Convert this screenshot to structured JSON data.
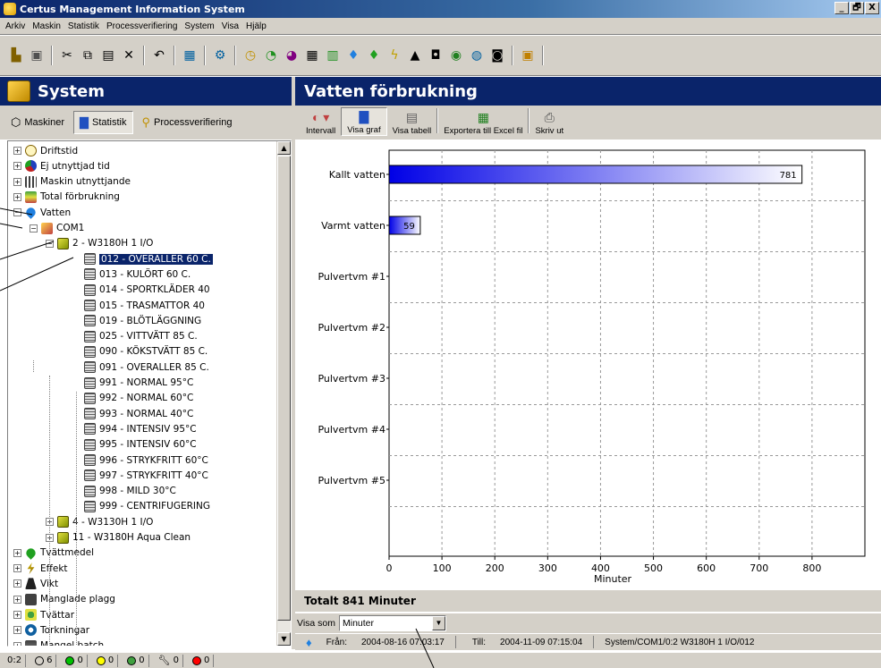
{
  "window": {
    "title": "Certus Management Information System",
    "controls": [
      "_",
      "🗗",
      "X"
    ]
  },
  "menu": [
    "Arkiv",
    "Maskin",
    "Statistik",
    "Processverifiering",
    "System",
    "Visa",
    "Hjälp"
  ],
  "left_panel": {
    "title": "System",
    "tabs": [
      {
        "label": "Maskiner",
        "icon": "cube-icon",
        "active": false
      },
      {
        "label": "Statistik",
        "icon": "bar-chart-icon",
        "active": true
      },
      {
        "label": "Processverifiering",
        "icon": "magnifier-icon",
        "active": false
      }
    ]
  },
  "tree": {
    "root": [
      {
        "label": "Driftstid",
        "icon": "clock-icon"
      },
      {
        "label": "Ej utnyttjad tid",
        "icon": "pie-icon"
      },
      {
        "label": "Maskin utnyttjande",
        "icon": "grid-icon"
      },
      {
        "label": "Total förbrukning",
        "icon": "calculator-icon"
      },
      {
        "label": "Vatten",
        "icon": "water-drop-icon"
      }
    ],
    "com": "COM1",
    "machine": "2 - W3180H 1 I/O",
    "programs": [
      "012 - OVERALLER 60 C.",
      "013 - KULÖRT 60 C.",
      "014 - SPORTKLÄDER 40",
      "015 - TRASMATTOR 40",
      "019 - BLÖTLÄGGNING",
      "025 - VITTVÄTT 85 C.",
      "090 - KÖKSTVÄTT 85 C.",
      "091 - OVERALLER 85 C.",
      "991 - NORMAL 95°C",
      "992 - NORMAL 60°C",
      "993 - NORMAL 40°C",
      "994 - INTENSIV 95°C",
      "995 - INTENSIV 60°C",
      "996 - STRYKFRITT 60°C",
      "997 - STRYKFRITT 40°C",
      "998 - MILD 30°C",
      "999 - CENTRIFUGERING"
    ],
    "other_machines": [
      "4 - W3130H 1 I/O",
      "11 - W3180H Aqua Clean"
    ],
    "tail": [
      {
        "label": "Tvättmedel",
        "icon": "detergent-icon"
      },
      {
        "label": "Effekt",
        "icon": "lightning-icon"
      },
      {
        "label": "Vikt",
        "icon": "weight-icon"
      },
      {
        "label": "Manglade plagg",
        "icon": "clothes-icon"
      },
      {
        "label": "Tvättar",
        "icon": "washer-icon"
      },
      {
        "label": "Torkningar",
        "icon": "dryer-icon"
      },
      {
        "label": "Mangel batch",
        "icon": "mangle-icon"
      }
    ]
  },
  "right_panel": {
    "title": "Vatten förbrukning",
    "tools": [
      {
        "label": "Intervall",
        "icon": "interval-icon",
        "active": false
      },
      {
        "label": "Visa graf",
        "icon": "graph-icon",
        "active": true
      },
      {
        "label": "Visa tabell",
        "icon": "table-icon",
        "active": false
      },
      {
        "label": "Exportera till Excel fil",
        "icon": "excel-icon",
        "active": false
      },
      {
        "label": "Skriv ut",
        "icon": "printer-icon",
        "active": false
      }
    ]
  },
  "chart_data": {
    "type": "bar",
    "orientation": "horizontal",
    "categories": [
      "Kallt vatten",
      "Varmt vatten",
      "Pulvertvm #1",
      "Pulvertvm #2",
      "Pulvertvm #3",
      "Pulvertvm #4",
      "Pulvertvm #5"
    ],
    "values": [
      781,
      59,
      0,
      0,
      0,
      0,
      0
    ],
    "data_labels": [
      "781",
      "59",
      "",
      "",
      "",
      "",
      ""
    ],
    "xlabel": "Minuter",
    "xlim": [
      0,
      900
    ],
    "xticks": [
      0,
      100,
      200,
      300,
      400,
      500,
      600,
      700,
      800
    ],
    "grid": true,
    "colors": {
      "bar_start": "#0000e6",
      "bar_end": "#ffffff"
    }
  },
  "total": {
    "text": "Totalt 841 Minuter"
  },
  "visa_som": {
    "label": "Visa som",
    "value": "Minuter"
  },
  "info": {
    "fran_label": "Från:",
    "fran_value": "2004-08-16 07:03:17",
    "till_label": "Till:",
    "till_value": "2004-11-09 07:15:04",
    "path": "System/COM1/0:2 W3180H 1 I/O/012"
  },
  "status": [
    {
      "text": "0:2",
      "color": ""
    },
    {
      "text": "6",
      "color": "#d4d0c8"
    },
    {
      "text": "0",
      "color": "#00c000"
    },
    {
      "text": "0",
      "color": "#ffff00"
    },
    {
      "text": "0",
      "color": "#40a040"
    },
    {
      "text": "0",
      "color": "#d4d0c8"
    },
    {
      "text": "0",
      "color": "#ff0000"
    }
  ]
}
